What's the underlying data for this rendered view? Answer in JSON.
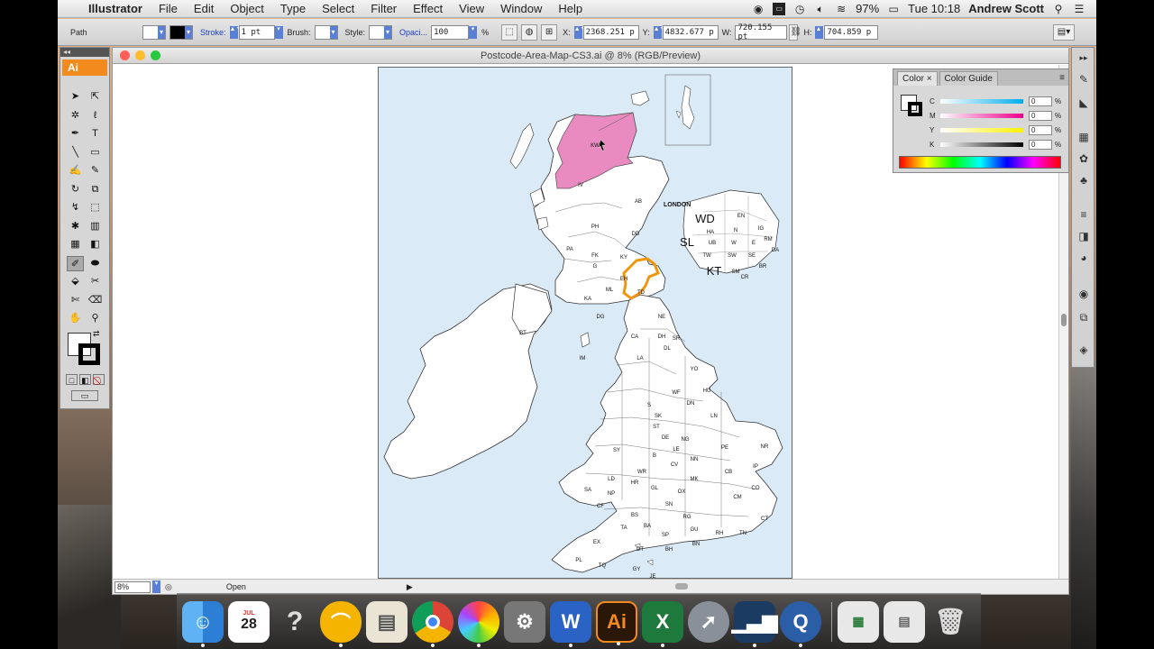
{
  "menubar": {
    "app": "Illustrator",
    "items": [
      "File",
      "Edit",
      "Object",
      "Type",
      "Select",
      "Filter",
      "Effect",
      "View",
      "Window",
      "Help"
    ],
    "battery": "97%",
    "clock": "Tue 10:18",
    "user": "Andrew Scott"
  },
  "control": {
    "selection": "Path",
    "stroke_label": "Stroke:",
    "stroke_value": "1 pt",
    "brush_label": "Brush:",
    "style_label": "Style:",
    "opacity_label": "Opaci...",
    "opacity_value": "100",
    "percent": "%",
    "x_label": "X:",
    "x_value": "2368.251 p",
    "y_label": "Y:",
    "y_value": "4832.677 p",
    "w_label": "W:",
    "w_value": "720.155 pt",
    "h_label": "H:",
    "h_value": "704.859 p"
  },
  "document": {
    "title": "Postcode-Area-Map-CS3.ai @ 8% (RGB/Preview)",
    "zoom": "8%",
    "status": "Open"
  },
  "map": {
    "labels": [
      {
        "text": "KW"
      },
      {
        "text": "IV"
      },
      {
        "text": "AB"
      },
      {
        "text": "PH"
      },
      {
        "text": "DD"
      },
      {
        "text": "PA"
      },
      {
        "text": "FK"
      },
      {
        "text": "KY"
      },
      {
        "text": "G"
      },
      {
        "text": "EH"
      },
      {
        "text": "ML"
      },
      {
        "text": "KA"
      },
      {
        "text": "TD"
      },
      {
        "text": "DG"
      },
      {
        "text": "NE"
      },
      {
        "text": "BT"
      },
      {
        "text": "CA"
      },
      {
        "text": "IM"
      },
      {
        "text": "LA"
      },
      {
        "text": "DL"
      },
      {
        "text": "YO"
      },
      {
        "text": "SK"
      },
      {
        "text": "LN"
      },
      {
        "text": "NR"
      },
      {
        "text": "ST"
      },
      {
        "text": "LE"
      },
      {
        "text": "PE"
      },
      {
        "text": "SY"
      },
      {
        "text": "IP"
      },
      {
        "text": "LD"
      },
      {
        "text": "B"
      },
      {
        "text": "CV"
      },
      {
        "text": "CB"
      },
      {
        "text": "HR"
      },
      {
        "text": "MK"
      },
      {
        "text": "CO"
      },
      {
        "text": "SA"
      },
      {
        "text": "GL"
      },
      {
        "text": "OX"
      },
      {
        "text": "CM"
      },
      {
        "text": "CF"
      },
      {
        "text": "BS"
      },
      {
        "text": "RG"
      },
      {
        "text": "CT"
      },
      {
        "text": "BA"
      },
      {
        "text": "GU"
      },
      {
        "text": "RH"
      },
      {
        "text": "TN"
      },
      {
        "text": "EX"
      },
      {
        "text": "SP"
      },
      {
        "text": "DT"
      },
      {
        "text": "BH"
      },
      {
        "text": "BN"
      },
      {
        "text": "PL"
      },
      {
        "text": "TQ"
      },
      {
        "text": "GY"
      },
      {
        "text": "JE"
      },
      {
        "text": "NP"
      },
      {
        "text": "WR"
      },
      {
        "text": "NN"
      },
      {
        "text": "SN"
      },
      {
        "text": "TA"
      },
      {
        "text": "DH"
      },
      {
        "text": "SR"
      },
      {
        "text": "HU"
      },
      {
        "text": "DN"
      },
      {
        "text": "DE"
      },
      {
        "text": "NG"
      },
      {
        "text": "S"
      },
      {
        "text": "WF"
      }
    ],
    "london": {
      "title": "LONDON",
      "labels": [
        {
          "text": "WD"
        },
        {
          "text": "EN"
        },
        {
          "text": "HA"
        },
        {
          "text": "N"
        },
        {
          "text": "IG"
        },
        {
          "text": "SL"
        },
        {
          "text": "UB"
        },
        {
          "text": "W"
        },
        {
          "text": "E"
        },
        {
          "text": "RM"
        },
        {
          "text": "TW"
        },
        {
          "text": "SW"
        },
        {
          "text": "SE"
        },
        {
          "text": "DA"
        },
        {
          "text": "BR"
        },
        {
          "text": "KT"
        },
        {
          "text": "SM"
        },
        {
          "text": "CR"
        }
      ]
    },
    "colors": {
      "sea": "#dbeaf7",
      "land": "#ffffff",
      "highlight": "#e98bc1",
      "outline": "#f0960e"
    }
  },
  "tools": {
    "title": "Ai",
    "icons": [
      "selection-tool",
      "direct-selection-tool",
      "magic-wand-tool",
      "lasso-tool",
      "pen-tool",
      "type-tool",
      "line-tool",
      "rectangle-tool",
      "paintbrush-tool",
      "pencil-tool",
      "rotate-tool",
      "scale-tool",
      "warp-tool",
      "free-transform-tool",
      "symbol-sprayer-tool",
      "graph-tool",
      "mesh-tool",
      "gradient-tool",
      "eyedropper-tool",
      "blend-tool",
      "live-paint-tool",
      "slice-tool",
      "scissors-tool",
      "eraser-tool",
      "hand-tool",
      "zoom-tool"
    ]
  },
  "color_panel": {
    "tab_color": "Color",
    "tab_guide": "Color Guide",
    "channels": [
      {
        "label": "C",
        "value": "0",
        "unit": "%"
      },
      {
        "label": "M",
        "value": "0",
        "unit": "%"
      },
      {
        "label": "Y",
        "value": "0",
        "unit": "%"
      },
      {
        "label": "K",
        "value": "0",
        "unit": "%"
      }
    ]
  },
  "dock": {
    "apps": [
      "finder",
      "calendar",
      "help",
      "sticky",
      "preview",
      "chrome",
      "photos",
      "system-preferences",
      "word",
      "illustrator",
      "excel",
      "launchpad",
      "activity-monitor",
      "quicktime",
      "spreadsheet",
      "documents",
      "trash"
    ],
    "calendar_month": "JUL",
    "calendar_day": "28",
    "illustrator_label": "Ai"
  }
}
